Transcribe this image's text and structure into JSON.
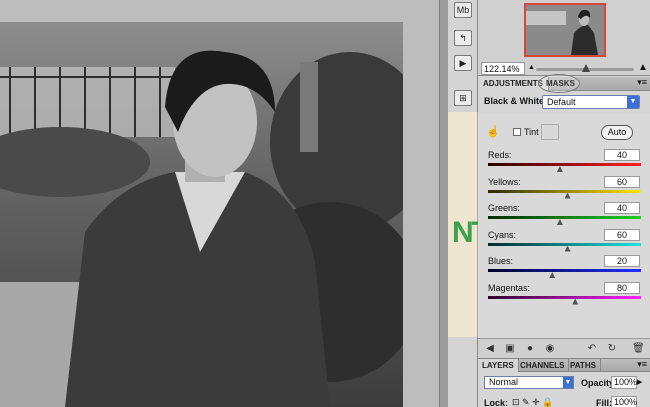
{
  "navigator": {
    "zoom": "122.14%"
  },
  "tool_strip": {
    "buttons": [
      "Mb"
    ]
  },
  "adjustments": {
    "tabs": [
      "ADJUSTMENTS",
      "MASKS"
    ],
    "panel_menu": "▾≡",
    "title": "Black & White",
    "preset": "Default",
    "tint_label": "Tint",
    "auto_label": "Auto",
    "sliders": [
      {
        "label": "Reds:",
        "value": "40",
        "knob_pos": 0.47
      },
      {
        "label": "Yellows:",
        "value": "60",
        "knob_pos": 0.52
      },
      {
        "label": "Greens:",
        "value": "40",
        "knob_pos": 0.47
      },
      {
        "label": "Cyans:",
        "value": "60",
        "knob_pos": 0.52
      },
      {
        "label": "Blues:",
        "value": "20",
        "knob_pos": 0.42
      },
      {
        "label": "Magentas:",
        "value": "80",
        "knob_pos": 0.57
      }
    ]
  },
  "layers": {
    "tabs": [
      "LAYERS",
      "CHANNELS",
      "PATHS"
    ],
    "blend_mode": "Normal",
    "opacity_label": "Opacity:",
    "opacity_value": "100%",
    "lock_label": "Lock:",
    "fill_label": "Fill:",
    "fill_value": "100%"
  },
  "background_doc": {
    "fragment": "NT"
  }
}
